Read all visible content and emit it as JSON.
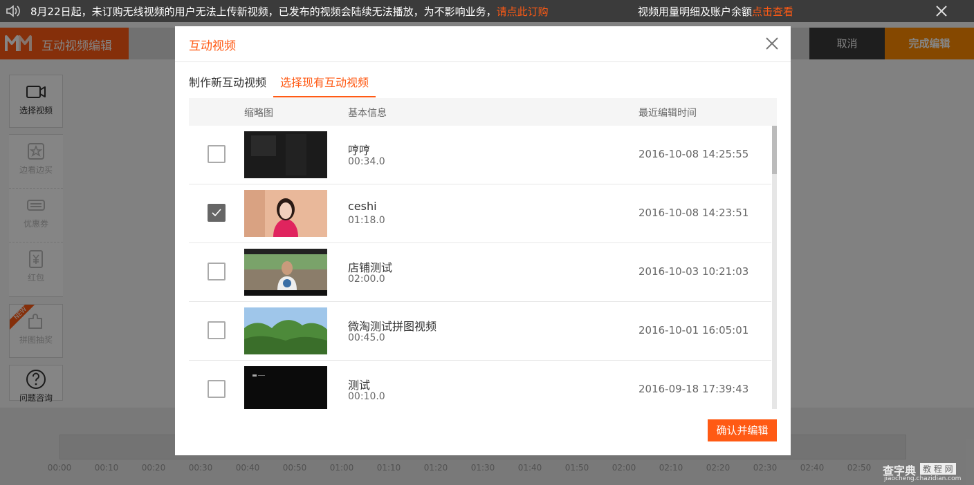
{
  "notice": {
    "message": "8月22日起，未订购无线视频的用户无法上传新视频，已发布的视频会陆续无法播放，为不影响业务，",
    "message_link": "请点此订购",
    "usage_text": "视频用量明细及账户余额",
    "usage_link": "点击查看"
  },
  "header": {
    "app_title": "互动视频编辑",
    "cancel": "取消",
    "finish": "完成编辑"
  },
  "toolbar": {
    "select_video": "选择视频",
    "items": [
      {
        "label": "边看边买",
        "icon": "star-badge-icon"
      },
      {
        "label": "优惠券",
        "icon": "coupon-icon"
      },
      {
        "label": "红包",
        "icon": "red-packet-icon"
      }
    ],
    "puzzle": "拼图抽奖",
    "new_badge": "NEW",
    "help": "问题咨询"
  },
  "timeline": {
    "ticks": [
      "00:00",
      "00:10",
      "00:20",
      "00:30",
      "00:40",
      "00:50",
      "01:00",
      "01:10",
      "01:20",
      "01:30",
      "01:40",
      "01:50",
      "02:00",
      "02:10",
      "02:20",
      "02:30",
      "02:40",
      "02:50"
    ]
  },
  "modal": {
    "title": "互动视频",
    "tabs": [
      "制作新互动视频",
      "选择现有互动视频"
    ],
    "active_tab": 1,
    "columns": {
      "thumb": "缩略图",
      "info": "基本信息",
      "time": "最近编辑时间"
    },
    "confirm": "确认并编辑",
    "videos": [
      {
        "name": "哼哼",
        "duration": "00:34.0",
        "edited": "2016-10-08 14:25:55",
        "checked": false,
        "thumb": "dark"
      },
      {
        "name": "ceshi",
        "duration": "01:18.0",
        "edited": "2016-10-08 14:23:51",
        "checked": true,
        "thumb": "person-pink"
      },
      {
        "name": "店铺测试",
        "duration": "02:00.0",
        "edited": "2016-10-03 10:21:03",
        "checked": false,
        "thumb": "street"
      },
      {
        "name": "微淘测试拼图视频",
        "duration": "00:45.0",
        "edited": "2016-10-01 16:05:01",
        "checked": false,
        "thumb": "trees"
      },
      {
        "name": "测试",
        "duration": "00:10.0",
        "edited": "2016-09-18 17:39:43",
        "checked": false,
        "thumb": "black"
      }
    ]
  },
  "watermark": {
    "brand": "查字典",
    "section": "教 程 网",
    "url": "jiaocheng.chazidian.com"
  },
  "colors": {
    "accent": "#ff5a14",
    "finish": "#ff8a00",
    "dark": "#3b3b3b"
  }
}
